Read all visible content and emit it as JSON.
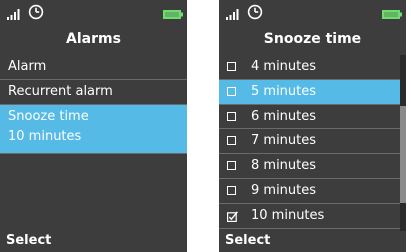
{
  "colors": {
    "background": "#3d3d3d",
    "highlight": "#55bbe6",
    "text": "#ffffff",
    "battery": "#6fdc6f",
    "divider": "#6a6a6a"
  },
  "left_screen": {
    "status_icons": [
      "signal-icon",
      "clock-icon",
      "battery-icon"
    ],
    "title": "Alarms",
    "items": [
      {
        "label": "Alarm"
      },
      {
        "label": "Recurrent alarm"
      },
      {
        "label": "Snooze time",
        "value": "10 minutes",
        "selected": true
      }
    ],
    "softkey": "Select"
  },
  "right_screen": {
    "status_icons": [
      "signal-icon",
      "clock-icon",
      "battery-icon"
    ],
    "title": "Snooze time",
    "options": [
      {
        "label": "4 minutes",
        "checked": false,
        "selected": false
      },
      {
        "label": "5 minutes",
        "checked": false,
        "selected": true
      },
      {
        "label": "6 minutes",
        "checked": false,
        "selected": false
      },
      {
        "label": "7 minutes",
        "checked": false,
        "selected": false
      },
      {
        "label": "8 minutes",
        "checked": false,
        "selected": false
      },
      {
        "label": "9 minutes",
        "checked": false,
        "selected": false
      },
      {
        "label": "10 minutes",
        "checked": true,
        "selected": false
      }
    ],
    "scroll_position_fraction": 0.55,
    "softkey": "Select"
  }
}
